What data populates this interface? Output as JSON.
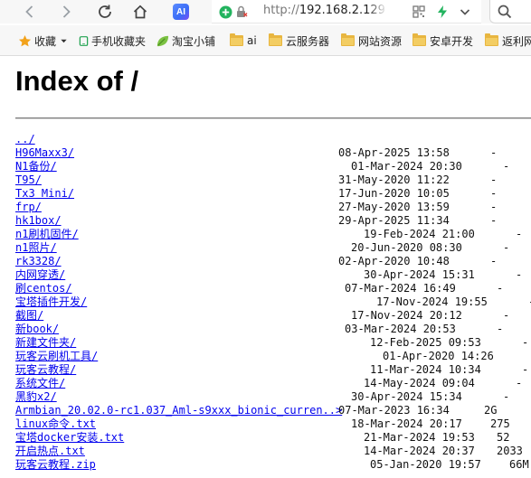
{
  "browser": {
    "url": "http://192.168.2.129:",
    "address_prefix": "http://",
    "address_host": "192.168.2.129:",
    "extension_badge": "AI"
  },
  "bookmarks": [
    {
      "label": "收藏",
      "icon": "star-icon"
    },
    {
      "label": "手机收藏夹",
      "icon": "phone-icon"
    },
    {
      "label": "淘宝小铺",
      "icon": "leaf-icon"
    },
    {
      "label": "ai",
      "icon": "folder-icon"
    },
    {
      "label": "云服务器",
      "icon": "folder-icon"
    },
    {
      "label": "网站资源",
      "icon": "folder-icon"
    },
    {
      "label": "安卓开发",
      "icon": "folder-icon"
    },
    {
      "label": "返利网",
      "icon": "folder-icon"
    }
  ],
  "page": {
    "title": "Index of /",
    "parent_link": "../"
  },
  "entries": [
    {
      "name": "H96Maxx3/",
      "date": "08-Apr-2025 13:58",
      "size": "-"
    },
    {
      "name": "N1备份/",
      "date": "01-Mar-2024 20:30",
      "size": "-"
    },
    {
      "name": "T95/",
      "date": "31-May-2020 11:22",
      "size": "-"
    },
    {
      "name": "Tx3 Mini/",
      "date": "17-Jun-2020 10:05",
      "size": "-"
    },
    {
      "name": "frp/",
      "date": "27-May-2020 13:59",
      "size": "-"
    },
    {
      "name": "hk1box/",
      "date": "29-Apr-2025 11:34",
      "size": "-"
    },
    {
      "name": "n1刷机固件/",
      "date": "19-Feb-2024 21:00",
      "size": "-"
    },
    {
      "name": "n1照片/",
      "date": "20-Jun-2020 08:30",
      "size": "-"
    },
    {
      "name": "rk3328/",
      "date": "02-Apr-2020 10:48",
      "size": "-"
    },
    {
      "name": "内网穿透/",
      "date": "30-Apr-2024 15:31",
      "size": "-"
    },
    {
      "name": "刷centos/",
      "date": "07-Mar-2024 16:49",
      "size": "-"
    },
    {
      "name": "宝塔插件开发/",
      "date": "17-Nov-2024 19:55",
      "size": "-"
    },
    {
      "name": "截图/",
      "date": "17-Nov-2024 20:12",
      "size": "-"
    },
    {
      "name": "新book/",
      "date": "03-Mar-2024 20:53",
      "size": "-"
    },
    {
      "name": "新建文件夹/",
      "date": "12-Feb-2025 09:53",
      "size": "-"
    },
    {
      "name": "玩客云刷机工具/",
      "date": "01-Apr-2020 14:26",
      "size": "-"
    },
    {
      "name": "玩客云教程/",
      "date": "11-Mar-2024 10:34",
      "size": "-"
    },
    {
      "name": "系统文件/",
      "date": "14-May-2024 09:04",
      "size": "-"
    },
    {
      "name": "黑豹x2/",
      "date": "30-Apr-2024 15:34",
      "size": "-"
    },
    {
      "name": "Armbian_20.02.0-rc1.037_Aml-s9xxx_bionic_curren..>",
      "date": "07-Mar-2023 16:34",
      "size": "2G"
    },
    {
      "name": "linux命令.txt",
      "date": "18-Mar-2024 20:17",
      "size": "275"
    },
    {
      "name": "宝塔docker安装.txt",
      "date": "21-Mar-2024 19:53",
      "size": "52"
    },
    {
      "name": "开启热点.txt",
      "date": "14-Mar-2024 20:37",
      "size": "2033"
    },
    {
      "name": "玩客云教程.zip",
      "date": "05-Jan-2020 19:57",
      "size": "66M"
    }
  ],
  "colors": {
    "link": "#0000ee",
    "accent_green": "#22b35e",
    "accent_ai": "#3b6cf6"
  }
}
